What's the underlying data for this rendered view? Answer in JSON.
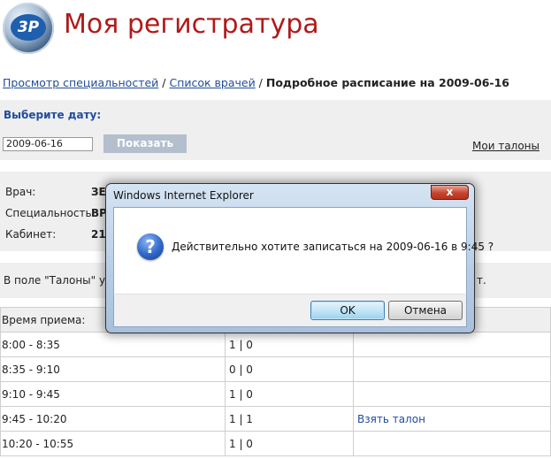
{
  "header": {
    "logo_text": "3P",
    "title": "Моя регистратура"
  },
  "breadcrumb": {
    "link1": "Просмотр специальностей",
    "sep1": " / ",
    "link2": "Список врачей",
    "sep2": " / ",
    "current": "Подробное расписание на 2009-06-16"
  },
  "date_panel": {
    "label": "Выберите дату:",
    "date_value": "2009-06-16",
    "show_button": "Показать",
    "my_tickets_link": "Мои талоны"
  },
  "info": {
    "doctor_label": "Врач:",
    "doctor_value": "ЗЕ",
    "specialty_label": "Специальность:",
    "specialty_value": "ВР",
    "cabinet_label": "Кабинет:",
    "cabinet_value": "21"
  },
  "note": {
    "text": "В поле \"Талоны\" ука",
    "tail": "т."
  },
  "schedule": {
    "header": {
      "col1": "Время приема:",
      "col2": "",
      "col3": ""
    },
    "rows": [
      {
        "time": "8:00 - 8:35",
        "tickets": "1 | 0",
        "action": ""
      },
      {
        "time": "8:35 - 9:10",
        "tickets": "0 | 0",
        "action": ""
      },
      {
        "time": "9:10 - 9:45",
        "tickets": "1 | 0",
        "action": ""
      },
      {
        "time": "9:45 - 10:20",
        "tickets": "1 | 1",
        "action": "Взять талон"
      },
      {
        "time": "10:20 - 10:55",
        "tickets": "1 | 0",
        "action": ""
      }
    ]
  },
  "dialog": {
    "title": "Windows Internet Explorer",
    "close_label": "x",
    "icon": "question-icon",
    "message": "Действительно хотите записаться на 2009-06-16 в 9:45 ?",
    "ok_label": "OK",
    "cancel_label": "Отмена"
  }
}
